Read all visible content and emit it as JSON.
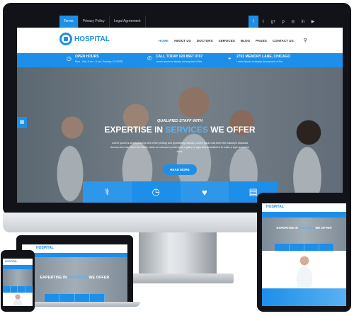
{
  "colors": {
    "accent": "#1d8fe9",
    "dark": "#111318"
  },
  "topbar": {
    "links": [
      {
        "label": "Terms",
        "active": true
      },
      {
        "label": "Privacy Policy",
        "active": false
      },
      {
        "label": "Legal Agreement",
        "active": false
      }
    ],
    "social": [
      {
        "icon": "facebook-icon",
        "glyph": "f"
      },
      {
        "icon": "twitter-icon",
        "glyph": "t"
      },
      {
        "icon": "google-plus-icon",
        "glyph": "g+"
      },
      {
        "icon": "pinterest-icon",
        "glyph": "p"
      },
      {
        "icon": "instagram-icon",
        "glyph": "◎"
      },
      {
        "icon": "linkedin-icon",
        "glyph": "in"
      },
      {
        "icon": "youtube-icon",
        "glyph": "▶"
      }
    ]
  },
  "brand": {
    "name": "HOSPITAL"
  },
  "menu": {
    "items": [
      {
        "label": "HOME",
        "active": true
      },
      {
        "label": "ABOUT US",
        "active": false
      },
      {
        "label": "DOCTORS",
        "active": false
      },
      {
        "label": "SERVICES",
        "active": false
      },
      {
        "label": "BLOG",
        "active": false
      },
      {
        "label": "PAGES",
        "active": false
      },
      {
        "label": "CONTACT US",
        "active": false
      }
    ],
    "search_icon": "search-icon"
  },
  "infobar": {
    "hours": {
      "title": "OPEN HOURS",
      "sub": "Mon - Sat, 8 am - 5 pm, Sunday: CLOSED",
      "icon": "clock-icon"
    },
    "call": {
      "title": "CALL TODAY 020 8567 0707",
      "sub": "Lorem Ipsum is simply dummy text of the.",
      "icon": "phone-icon"
    },
    "address": {
      "title": "2702 MEMORY LANE, CHICAGO",
      "sub": "Lorem Ipsum is simply dummy text of the.",
      "icon": "map-pin-icon"
    }
  },
  "hero": {
    "kicker": "QUALIFIED STAFF WITH",
    "headline_pre": "EXPERTISE IN ",
    "headline_highlight": "SERVICES",
    "headline_post": " WE OFFER",
    "paragraph": "Lorem Ipsum is simply dummy text of the printing and typesetting industry. Lorem Ipsum has been the industry's standard dummy text ever since the 1500s, when an unknown printer took a galley of type and scrambled it to make a type specimen book.",
    "button": "READ MORE",
    "calendar_icon": "calendar-icon",
    "features": [
      {
        "icon": "doctor-icon",
        "glyph": "⚕"
      },
      {
        "icon": "clock-24-icon",
        "glyph": "◷"
      },
      {
        "icon": "heart-icon",
        "glyph": "♥"
      },
      {
        "icon": "newspaper-icon",
        "glyph": "▤"
      }
    ]
  },
  "laptop": {
    "brand": "HOSPITAL",
    "headline_pre": "EXPERTISE IN ",
    "headline_highlight": "SERVICES",
    "headline_post": " WE OFFER"
  },
  "tablet": {
    "brand": "HOSPITAL",
    "headline_pre": "EXPERTISE IN ",
    "headline_highlight": "SERVICES",
    "headline_post": " WE OFFER"
  },
  "phone": {
    "brand": "HOSPITAL"
  }
}
